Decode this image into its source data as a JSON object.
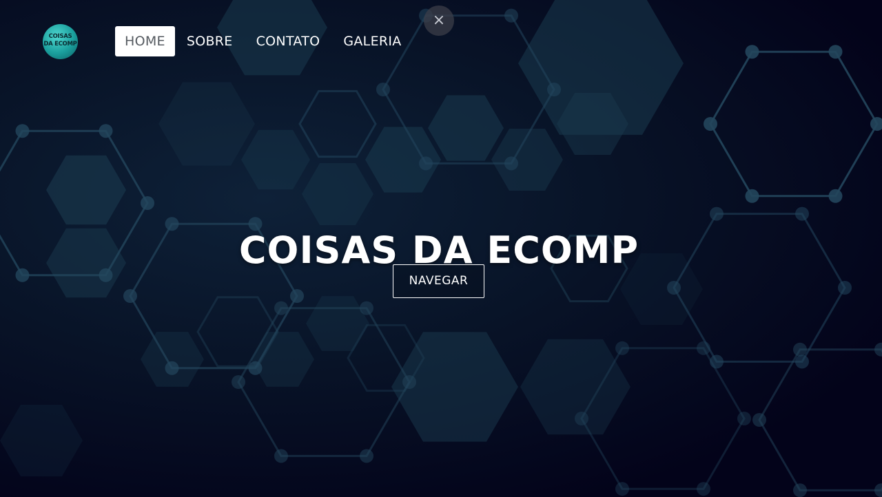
{
  "close_button": {
    "label": "×",
    "icon": "close-icon"
  },
  "logo": {
    "line1": "COISAS",
    "line2": "DA ECOMP",
    "color": "#1a9e9c"
  },
  "nav": {
    "items": [
      {
        "label": "HOME",
        "active": true
      },
      {
        "label": "SOBRE",
        "active": false
      },
      {
        "label": "CONTATO",
        "active": false
      },
      {
        "label": "GALERIA",
        "active": false
      }
    ]
  },
  "hero": {
    "title": "COISAS DA ECOMP",
    "cta_label": "NAVEGAR",
    "background": "hexagon-network",
    "colors": {
      "bg_dark": "#05051a",
      "hex_fill": "#1a3a4e",
      "hex_line": "#23465c"
    }
  }
}
